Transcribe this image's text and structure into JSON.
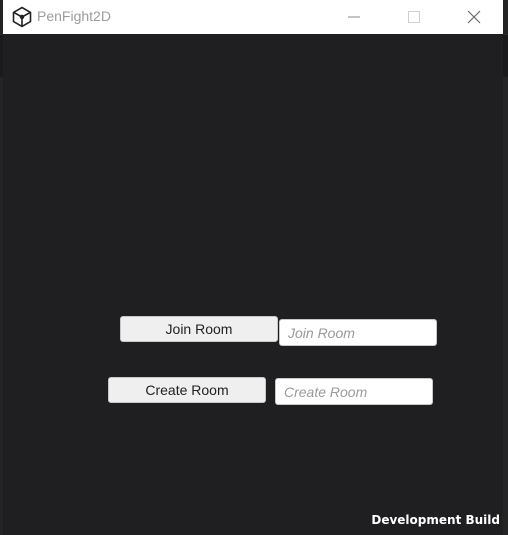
{
  "window": {
    "title": "PenFight2D",
    "icon": "unity-logo-icon",
    "controls": {
      "minimize": "minimize-icon",
      "maximize": "maximize-icon",
      "close": "close-icon"
    }
  },
  "game": {
    "join_button_label": "Join Room",
    "join_input": {
      "value": "",
      "placeholder": "Join Room"
    },
    "create_button_label": "Create Room",
    "create_input": {
      "value": "",
      "placeholder": "Create Room"
    }
  },
  "overlay": {
    "build_label": "Development Build"
  },
  "colors": {
    "titlebar": "#ffffff",
    "game_background": "#1f1f21",
    "button": "#efefef",
    "input": "#ffffff"
  }
}
